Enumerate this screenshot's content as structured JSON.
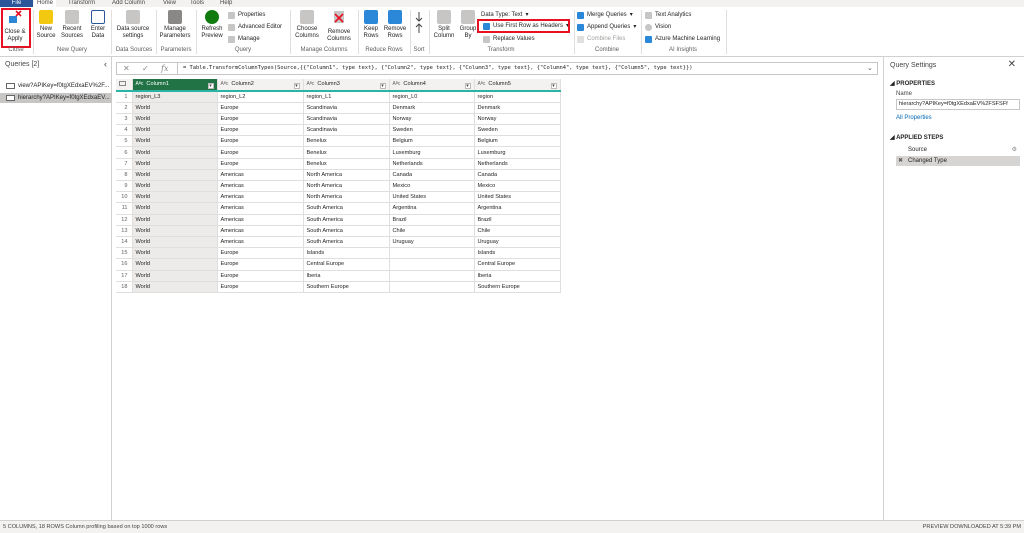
{
  "tabs": [
    "File",
    "Home",
    "Transform",
    "Add Column",
    "View",
    "Tools",
    "Help"
  ],
  "ribbon": {
    "close_apply": "Close & Apply",
    "new_source": "New Source",
    "recent_sources": "Recent Sources",
    "enter_data": "Enter Data",
    "data_source_settings": "Data source settings",
    "manage_parameters": "Manage Parameters",
    "refresh_preview": "Refresh Preview",
    "properties": "Properties",
    "advanced_editor": "Advanced Editor",
    "manage": "Manage",
    "choose_columns": "Choose Columns",
    "remove_columns": "Remove Columns",
    "keep_rows": "Keep Rows",
    "remove_rows": "Remove Rows",
    "split_column": "Split Column",
    "group_by": "Group By",
    "data_type": "Data Type: Text",
    "use_first_row": "Use First Row as Headers",
    "replace_values": "Replace Values",
    "merge_queries": "Merge Queries",
    "append_queries": "Append Queries",
    "combine_files": "Combine Files",
    "text_analytics": "Text Analytics",
    "vision": "Vision",
    "azure_ml": "Azure Machine Learning",
    "groups": {
      "close": "Close",
      "new_query": "New Query",
      "data_sources": "Data Sources",
      "parameters": "Parameters",
      "query": "Query",
      "manage_columns": "Manage Columns",
      "reduce_rows": "Reduce Rows",
      "sort": "Sort",
      "transform": "Transform",
      "combine": "Combine",
      "ai_insights": "AI Insights"
    }
  },
  "queries": {
    "header": "Queries [2]",
    "items": [
      "view?APIKey=f0tgXEdxaEV%2F...",
      "hierarchy?APIKey=f0tgXEdxaEV..."
    ]
  },
  "formula": "= Table.TransformColumnTypes(Source,{{\"Column1\", type text}, {\"Column2\", type text}, {\"Column3\", type text}, {\"Column4\", type text}, {\"Column5\", type text}})",
  "table": {
    "type_badge": "Aᴮc",
    "columns": [
      "Column1",
      "Column2",
      "Column3",
      "Column4",
      "Column5"
    ],
    "rows": [
      [
        "region_L3",
        "region_L2",
        "region_L1",
        "region_L0",
        "region"
      ],
      [
        "World",
        "Europe",
        "Scandinavia",
        "Denmark",
        "Denmark"
      ],
      [
        "World",
        "Europe",
        "Scandinavia",
        "Norway",
        "Norway"
      ],
      [
        "World",
        "Europe",
        "Scandinavia",
        "Sweden",
        "Sweden"
      ],
      [
        "World",
        "Europe",
        "Benelux",
        "Belgium",
        "Belgium"
      ],
      [
        "World",
        "Europe",
        "Benelux",
        "Luxemburg",
        "Luxemburg"
      ],
      [
        "World",
        "Europe",
        "Benelux",
        "Netherlands",
        "Netherlands"
      ],
      [
        "World",
        "Americas",
        "North America",
        "Canada",
        "Canada"
      ],
      [
        "World",
        "Americas",
        "North America",
        "Mexico",
        "Mexico"
      ],
      [
        "World",
        "Americas",
        "North America",
        "United States",
        "United States"
      ],
      [
        "World",
        "Americas",
        "South America",
        "Argentina",
        "Argentina"
      ],
      [
        "World",
        "Americas",
        "South America",
        "Brazil",
        "Brazil"
      ],
      [
        "World",
        "Americas",
        "South America",
        "Chile",
        "Chile"
      ],
      [
        "World",
        "Americas",
        "South America",
        "Uruguay",
        "Uruguay"
      ],
      [
        "World",
        "Europe",
        "Islands",
        "",
        "Islands"
      ],
      [
        "World",
        "Europe",
        "Central Europe",
        "",
        "Central Europe"
      ],
      [
        "World",
        "Europe",
        "Iberia",
        "",
        "Iberia"
      ],
      [
        "World",
        "Europe",
        "Southern Europe",
        "",
        "Southern Europe"
      ]
    ]
  },
  "settings": {
    "title": "Query Settings",
    "properties": "PROPERTIES",
    "name_label": "Name",
    "name_value": "hierarchy?APIKey=f0tgXEdxaEV%2FSFSFf",
    "all_properties": "All Properties",
    "applied_steps": "APPLIED STEPS",
    "steps": [
      "Source",
      "Changed Type"
    ]
  },
  "status": {
    "left": "5 COLUMNS, 18 ROWS     Column profiling based on top 1000 rows",
    "right": "PREVIEW DOWNLOADED AT 5:39 PM"
  },
  "colors": {
    "accent": "#2b579a",
    "highlight": "#e81123",
    "selected_column": "#217346"
  }
}
